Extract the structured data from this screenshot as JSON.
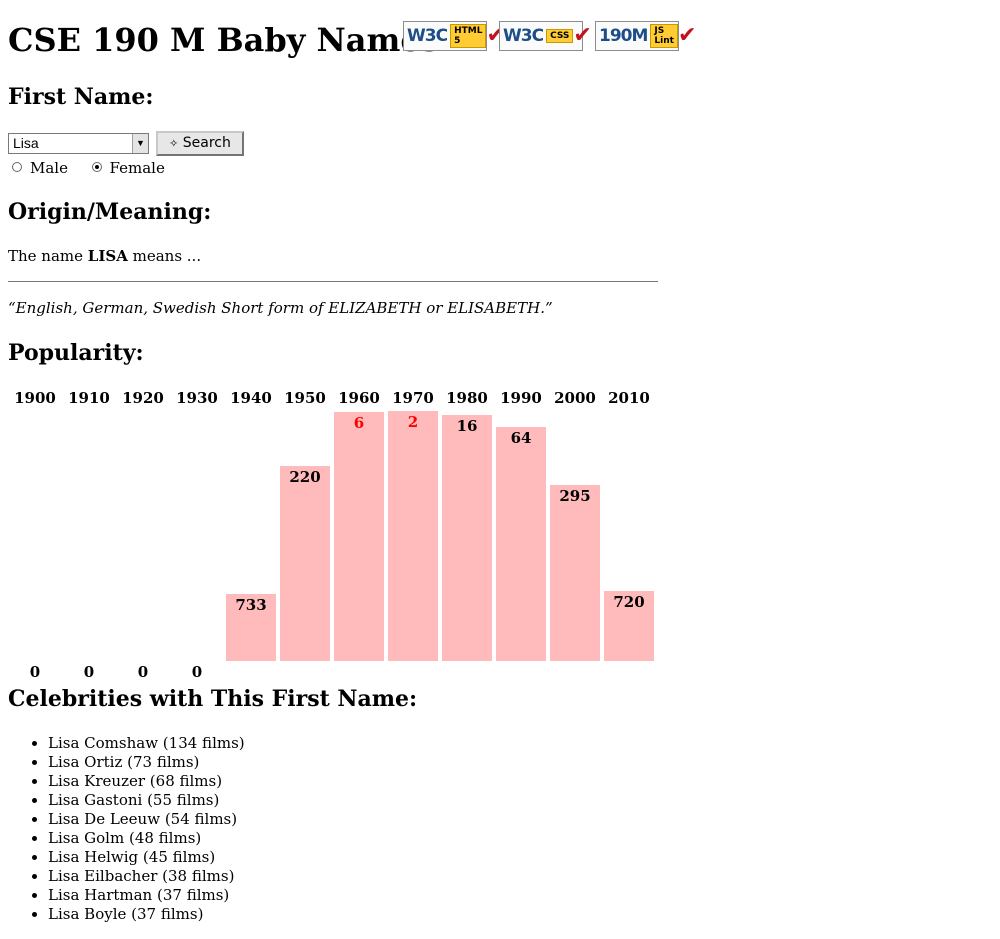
{
  "header": {
    "title": "CSE 190 M Baby Names",
    "badges": [
      {
        "label": "W3C",
        "tag": "HTML 5",
        "icon": "check-icon"
      },
      {
        "label": "W3C",
        "tag": "CSS",
        "icon": "check-icon"
      },
      {
        "label": "190M",
        "tag": "JS Lint",
        "icon": "check-icon"
      }
    ]
  },
  "first_name": {
    "heading": "First Name:",
    "selected_name": "Lisa",
    "search_label": "Search",
    "gender_options": [
      {
        "label": "Male",
        "checked": false
      },
      {
        "label": "Female",
        "checked": true
      }
    ]
  },
  "origin": {
    "heading": "Origin/Meaning:",
    "intro_prefix": "The name ",
    "name_upper": "LISA",
    "intro_suffix": " means ...",
    "meaning_quote": "“English, German, Swedish Short form of ELIZABETH or ELISABETH.”"
  },
  "popularity": {
    "heading": "Popularity:"
  },
  "chart_data": {
    "type": "bar",
    "categories": [
      "1900",
      "1910",
      "1920",
      "1930",
      "1940",
      "1950",
      "1960",
      "1970",
      "1980",
      "1990",
      "2000",
      "2010"
    ],
    "values": [
      0,
      0,
      0,
      0,
      733,
      220,
      6,
      2,
      16,
      64,
      295,
      720
    ],
    "value_meaning": "rank (lower is more popular, 0 = unranked)",
    "highlight_color": "#ff0000",
    "bar_color": "#ffbbbb"
  },
  "celebrities": {
    "heading": "Celebrities with This First Name:",
    "items": [
      "Lisa Comshaw (134 films)",
      "Lisa Ortiz (73 films)",
      "Lisa Kreuzer (68 films)",
      "Lisa Gastoni (55 films)",
      "Lisa De Leeuw (54 films)",
      "Lisa Golm (48 films)",
      "Lisa Helwig (45 films)",
      "Lisa Eilbacher (38 films)",
      "Lisa Hartman (37 films)",
      "Lisa Boyle (37 films)"
    ]
  }
}
